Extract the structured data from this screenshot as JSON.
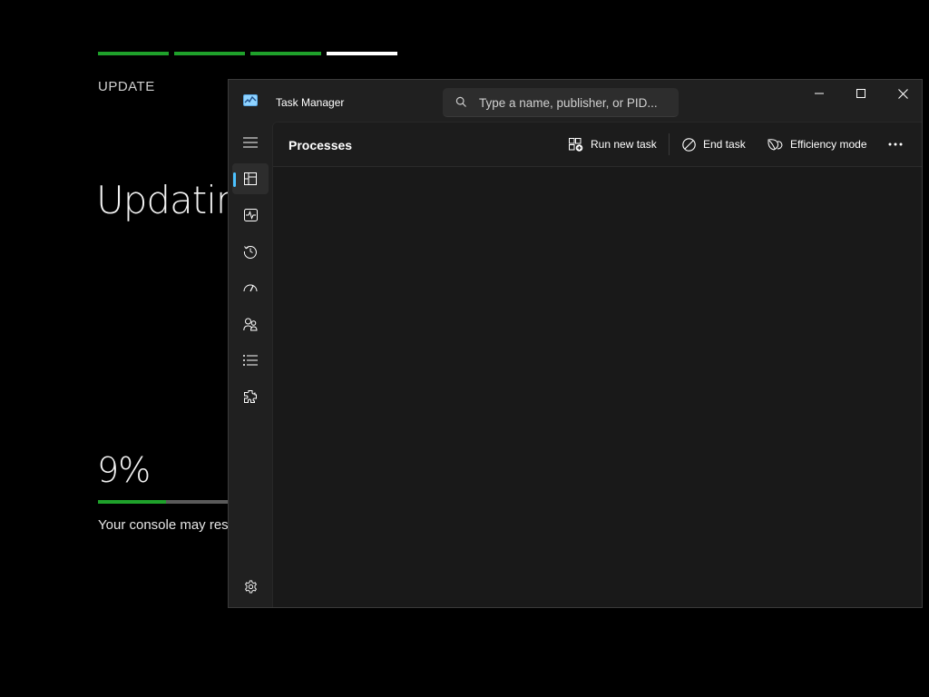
{
  "background": {
    "section_label": "UPDATE",
    "title": "Updating...",
    "percent": "9%",
    "progress": 0.5,
    "message": "Your console may restart",
    "colors": {
      "accent": "#1fa12b",
      "current_step": "#ffffff",
      "track": "#5a5a5a"
    }
  },
  "window": {
    "title": "Task Manager",
    "search": {
      "placeholder": "Type a name, publisher, or PID..."
    },
    "controls": {
      "minimize": "minimize-icon",
      "maximize": "maximize-icon",
      "close": "close-icon"
    }
  },
  "sidebar": {
    "items": [
      {
        "id": "menu",
        "icon": "hamburger-icon"
      },
      {
        "id": "processes",
        "icon": "processes-icon",
        "active": true
      },
      {
        "id": "performance",
        "icon": "performance-icon"
      },
      {
        "id": "app-history",
        "icon": "history-icon"
      },
      {
        "id": "startup-apps",
        "icon": "startup-icon"
      },
      {
        "id": "users",
        "icon": "users-icon"
      },
      {
        "id": "details",
        "icon": "details-icon"
      },
      {
        "id": "services",
        "icon": "services-icon"
      },
      {
        "id": "settings",
        "icon": "gear-icon"
      }
    ],
    "accent": "#4cc2ff"
  },
  "toolbar": {
    "title": "Processes",
    "run_new_task": "Run new task",
    "end_task": "End task",
    "efficiency_mode": "Efficiency mode",
    "more": "more-icon"
  }
}
